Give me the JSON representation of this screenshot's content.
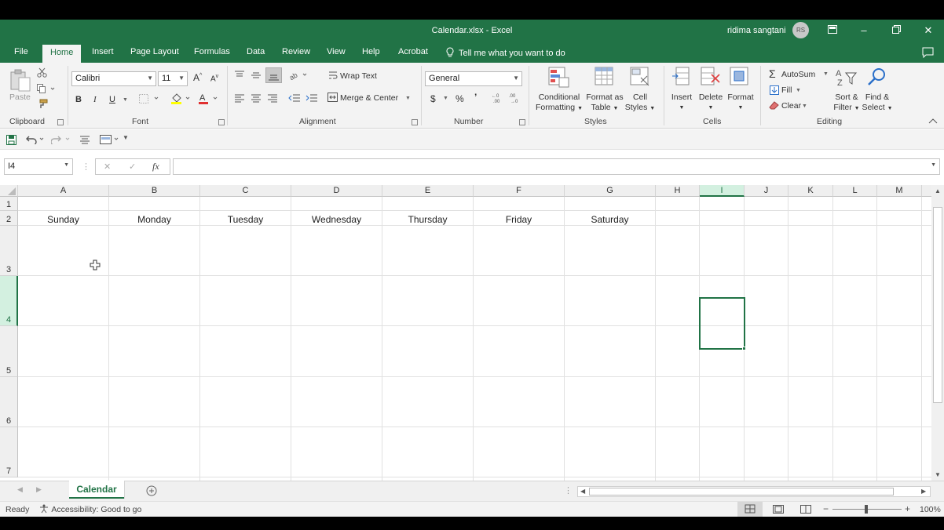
{
  "window": {
    "title": "Calendar.xlsx  -  Excel",
    "user": "ridima sangtani",
    "user_initials": "RS"
  },
  "tabs": [
    "File",
    "Home",
    "Insert",
    "Page Layout",
    "Formulas",
    "Data",
    "Review",
    "View",
    "Help",
    "Acrobat"
  ],
  "active_tab": "Home",
  "tellme": "Tell me what you want to do",
  "ribbon": {
    "clipboard": {
      "paste": "Paste",
      "label": "Clipboard"
    },
    "font": {
      "name": "Calibri",
      "size": "11",
      "bold": "B",
      "italic": "I",
      "underline": "U",
      "label": "Font"
    },
    "alignment": {
      "wrap": "Wrap Text",
      "merge": "Merge & Center",
      "label": "Alignment"
    },
    "number": {
      "format": "General",
      "label": "Number",
      "currency": "$",
      "percent": "%",
      "comma": "’"
    },
    "styles": {
      "conditional_1": "Conditional",
      "conditional_2": "Formatting",
      "table_1": "Format as",
      "table_2": "Table",
      "cell_1": "Cell",
      "cell_2": "Styles",
      "label": "Styles"
    },
    "cells": {
      "insert": "Insert",
      "delete": "Delete",
      "format": "Format",
      "label": "Cells"
    },
    "editing": {
      "autosum": "AutoSum",
      "fill": "Fill",
      "clear": "Clear",
      "sort_1": "Sort &",
      "sort_2": "Filter",
      "find_1": "Find &",
      "find_2": "Select",
      "label": "Editing"
    }
  },
  "formula_bar": {
    "name_box": "I4",
    "fx": "fx",
    "value": ""
  },
  "grid": {
    "columns": [
      "A",
      "B",
      "C",
      "D",
      "E",
      "F",
      "G",
      "H",
      "I",
      "J",
      "K",
      "L",
      "M"
    ],
    "rows": [
      "1",
      "2",
      "3",
      "4",
      "5",
      "6",
      "7"
    ],
    "selected_column": "I",
    "selected_row": "4",
    "row2_values": [
      "Sunday",
      "Monday",
      "Tuesday",
      "Wednesday",
      "Thursday",
      "Friday",
      "Saturday"
    ]
  },
  "sheets": [
    "Calendar"
  ],
  "status": {
    "ready": "Ready",
    "accessibility": "Accessibility: Good to go",
    "zoom": "100%"
  },
  "colors": {
    "accent": "#217346"
  }
}
